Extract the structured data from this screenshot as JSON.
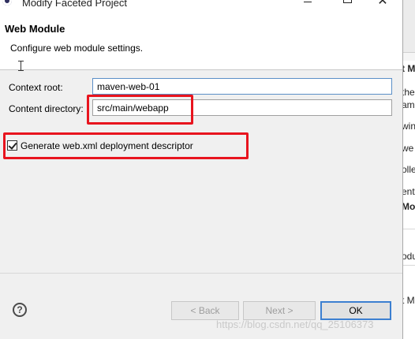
{
  "window": {
    "title": "Modify Faceted Project",
    "minimize_glyph": "",
    "maximize_glyph": "",
    "close_glyph": "✕"
  },
  "header": {
    "title": "Web Module",
    "description": "Configure web module settings."
  },
  "form": {
    "context_root_label": "Context root:",
    "context_root_value": "maven-web-01",
    "content_directory_label": "Content directory:",
    "content_directory_value": "src/main/webapp",
    "generate_web_xml_label": "Generate web.xml deployment descriptor",
    "generate_web_xml_checked": true
  },
  "footer": {
    "help_glyph": "?",
    "back_label": "< Back",
    "next_label": "Next >",
    "ok_label": "OK"
  },
  "watermark": "https://blog.csdn.net/qq_25106373",
  "background_fragment": {
    "lines": [
      "t Mo",
      "the",
      "ami",
      "win",
      "we",
      "olle",
      "ent",
      "Mo",
      "odu",
      "t M"
    ]
  },
  "colors": {
    "annotation": "#e8141e",
    "ok_border": "#3c7fd0"
  }
}
